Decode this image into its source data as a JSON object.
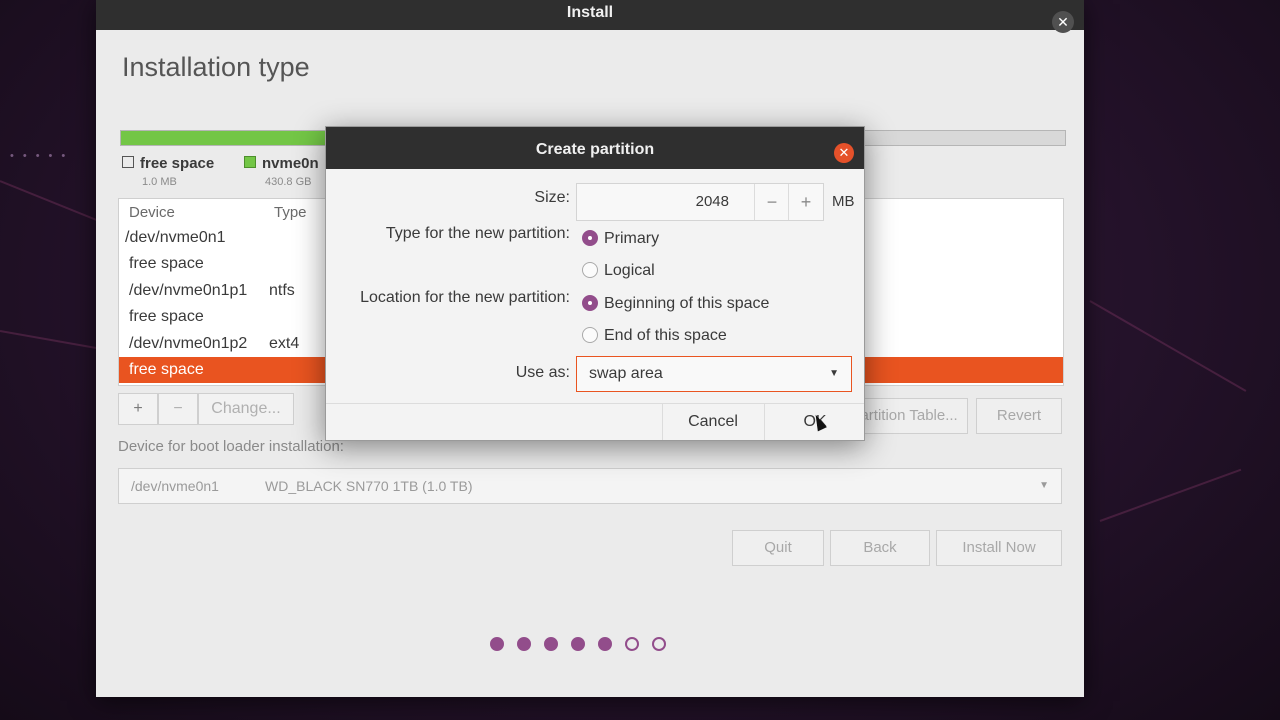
{
  "window": {
    "title": "Install",
    "close_icon": "close-icon"
  },
  "page": {
    "title": "Installation type"
  },
  "legend": [
    {
      "name": "free space",
      "size": "1.0 MB",
      "swatch": "#ffffff"
    },
    {
      "name": "nvme0n",
      "size": "430.8 GB",
      "swatch": "#73c646"
    }
  ],
  "table": {
    "headers": [
      "Device",
      "Type"
    ],
    "rows": [
      {
        "device": "/dev/nvme0n1",
        "type": ""
      },
      {
        "device": "free space",
        "type": ""
      },
      {
        "device": "/dev/nvme0n1p1",
        "type": "ntfs"
      },
      {
        "device": "free space",
        "type": ""
      },
      {
        "device": "/dev/nvme0n1p2",
        "type": "ext4"
      },
      {
        "device": "free space",
        "type": "",
        "selected": true
      }
    ]
  },
  "table_tools": {
    "add": "+",
    "remove": "−",
    "change": "Change...",
    "new_table": "New Partition Table...",
    "revert": "Revert"
  },
  "boot": {
    "label": "Device for boot loader installation:",
    "device": "/dev/nvme0n1",
    "model": "WD_BLACK SN770 1TB (1.0 TB)"
  },
  "buttons": {
    "quit": "Quit",
    "back": "Back",
    "install_now": "Install Now"
  },
  "progress": {
    "total": 7,
    "completed": 5
  },
  "dialog": {
    "title": "Create partition",
    "size_label": "Size:",
    "size_value": "2048",
    "size_unit": "MB",
    "minus": "−",
    "plus": "+",
    "type_label": "Type for the new partition:",
    "type_options": [
      "Primary",
      "Logical"
    ],
    "type_selected": "Primary",
    "location_label": "Location for the new partition:",
    "location_options": [
      "Beginning of this space",
      "End of this space"
    ],
    "location_selected": "Beginning of this space",
    "use_as_label": "Use as:",
    "use_as_value": "swap area",
    "cancel": "Cancel",
    "ok": "OK"
  },
  "colors": {
    "accent": "#e95420",
    "purple": "#924d8b",
    "green": "#73c646",
    "titlebar": "#2f2f2f"
  }
}
